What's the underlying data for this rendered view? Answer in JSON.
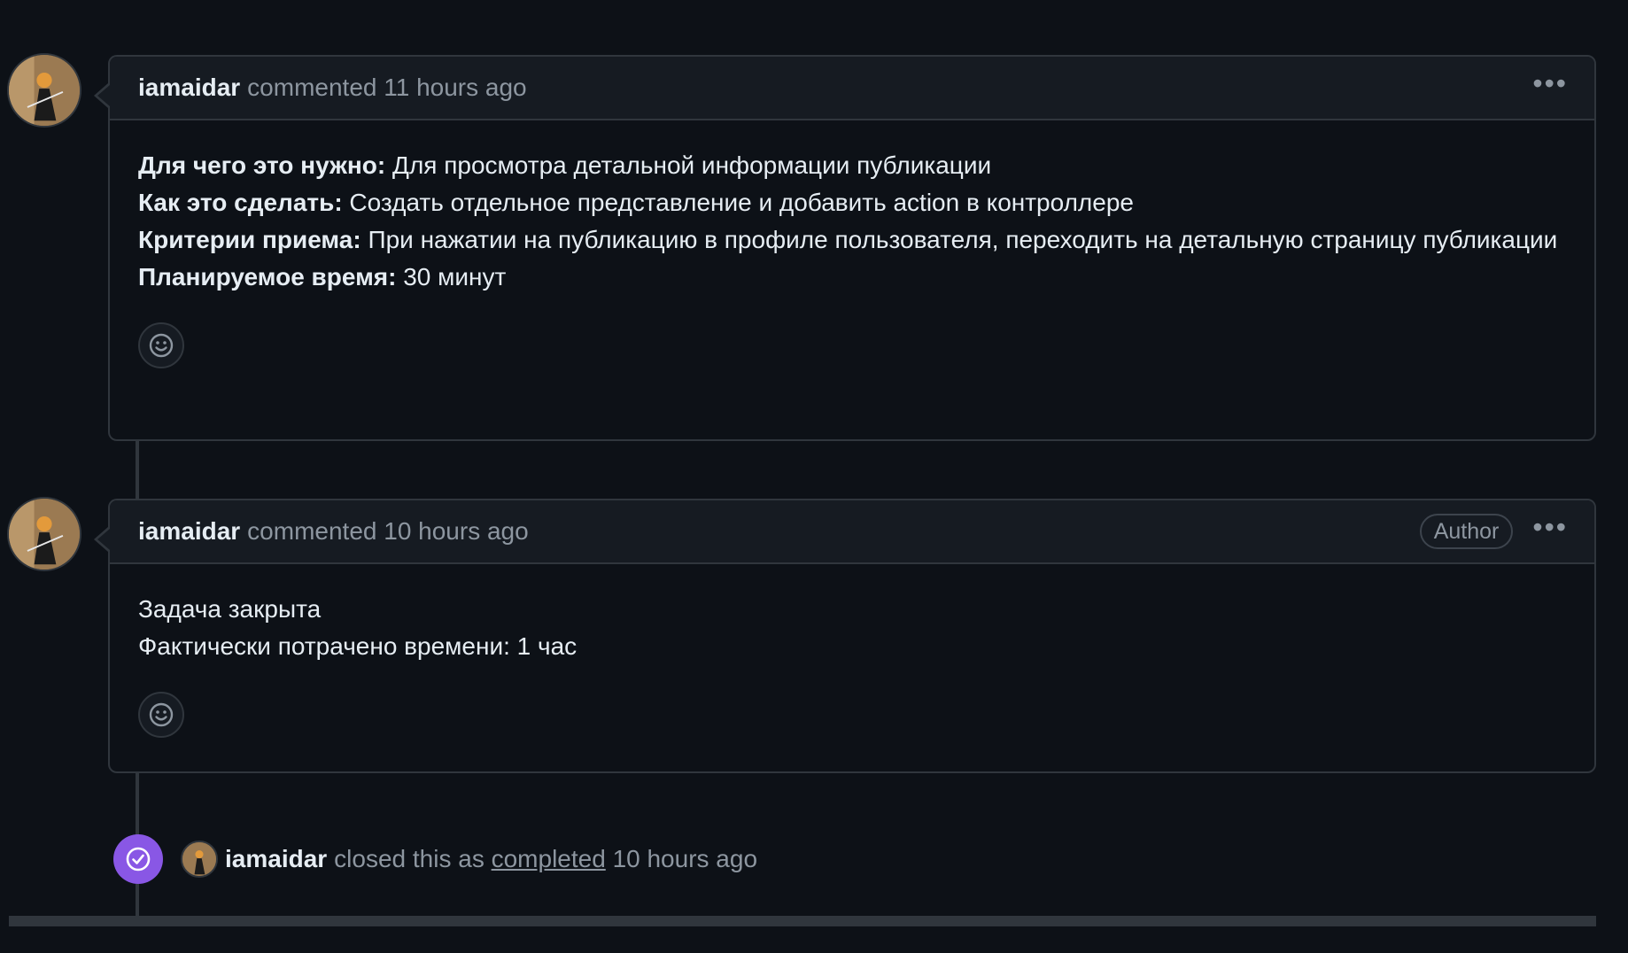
{
  "comments": [
    {
      "author": "iamaidar",
      "meta": "commented 11 hours ago",
      "badge": "",
      "lines": [
        {
          "label": "Для чего это нужно:",
          "text": " Для просмотра детальной информации публикации"
        },
        {
          "label": "Как это сделать:",
          "text": " Создать отдельное представление и добавить action в контроллере"
        },
        {
          "label": "Критерии приема:",
          "text": " При нажатии на публикацию в профиле пользователя, переходить на детальную страницу публикации"
        },
        {
          "label": "Планируемое время:",
          "text": " 30 минут"
        }
      ]
    },
    {
      "author": "iamaidar",
      "meta": "commented 10 hours ago",
      "badge": "Author",
      "lines": [
        {
          "label": "",
          "text": "Задача закрыта"
        },
        {
          "label": "",
          "text": "Фактически потрачено времени: 1 час"
        }
      ]
    }
  ],
  "event": {
    "author": "iamaidar",
    "text_before": "closed this as",
    "link": "completed",
    "text_after": "10 hours ago",
    "icon": "check-circle-icon",
    "icon_color": "#8957e5"
  },
  "menu_icon": "kebab-menu-icon",
  "reaction_icon": "smiley-icon",
  "colors": {
    "background": "#0d1117",
    "header": "#161b22",
    "border": "#30363d",
    "muted_text": "#8d96a0"
  }
}
